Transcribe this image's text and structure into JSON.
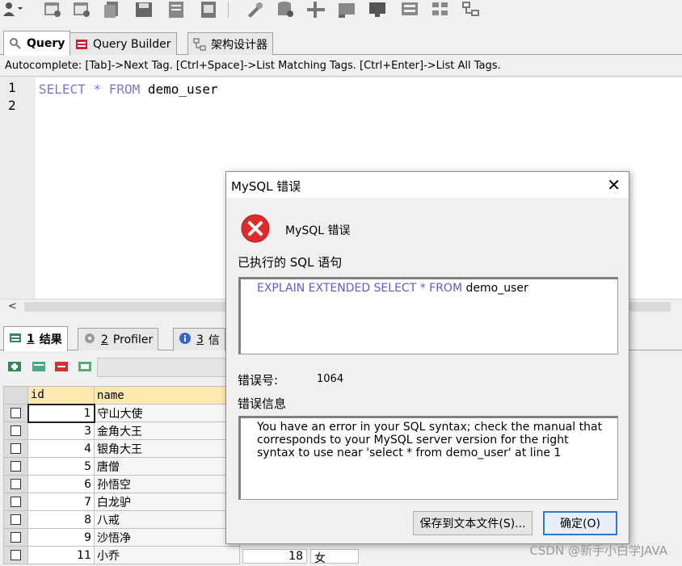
{
  "toolbar": {
    "icons": [
      "user-icon",
      "table-icon",
      "table-export-icon",
      "copy-icon",
      "save-icon",
      "document-icon",
      "report-icon",
      "wrench-icon",
      "database-icon",
      "plus-table-icon",
      "server-icon",
      "monitor-icon",
      "grid-icon",
      "grid-tree-icon"
    ]
  },
  "editor_tabs": [
    {
      "label": "Query",
      "icon": "query-icon",
      "active": true
    },
    {
      "label": "Query Builder",
      "icon": "query-builder-icon",
      "active": false
    },
    {
      "label": "架构设计器",
      "icon": "schema-designer-icon",
      "active": false
    }
  ],
  "autocomplete_hint": "Autocomplete: [Tab]->Next Tag. [Ctrl+Space]->List Matching Tags. [Ctrl+Enter]->List All Tags.",
  "editor": {
    "line_numbers": [
      "1",
      "2"
    ],
    "code": {
      "kw1": "SELECT",
      "star": "*",
      "kw2": "FROM",
      "table": "demo_user"
    }
  },
  "result_tabs": [
    {
      "num": "1",
      "label": "结果",
      "icon": "result-icon",
      "active": true
    },
    {
      "num": "2",
      "label": "Profiler",
      "icon": "profiler-icon",
      "active": false
    },
    {
      "num": "3",
      "label": "信",
      "icon": "info-icon",
      "active": false
    }
  ],
  "grid": {
    "columns": [
      "id",
      "name"
    ],
    "rows": [
      {
        "id": "1",
        "name": "守山大使"
      },
      {
        "id": "3",
        "name": "金角大王"
      },
      {
        "id": "4",
        "name": "银角大王"
      },
      {
        "id": "5",
        "name": "唐僧"
      },
      {
        "id": "6",
        "name": "孙悟空"
      },
      {
        "id": "7",
        "name": "白龙驴"
      },
      {
        "id": "8",
        "name": "八戒"
      },
      {
        "id": "9",
        "name": "沙悟净"
      },
      {
        "id": "11",
        "name": "小乔"
      }
    ],
    "last_row_extra": {
      "age": "18",
      "gender": "女"
    }
  },
  "dialog": {
    "title": "MySQL 错误",
    "close": "✕",
    "heading": "MySQL 错误",
    "executed_label": "已执行的 SQL 语句",
    "sql": {
      "keywords": "EXPLAIN EXTENDED SELECT * FROM",
      "table": "demo_user"
    },
    "errno_label": "错误号:",
    "errno": "1064",
    "errmsg_label": "错误信息",
    "errmsg": "You have an error in your SQL syntax; check the manual that corresponds to your MySQL server version for the right syntax to use near 'select * from demo_user' at line 1",
    "save_button": "保存到文本文件(S)...",
    "ok_button": "确定(O)"
  },
  "watermark": "CSDN @新手小白学JAVA",
  "colors": {
    "keyword": "#7a7ad6",
    "header_bg": "#ffe9b3",
    "error_red": "#e02a2a",
    "primary_border": "#2b79d8"
  }
}
